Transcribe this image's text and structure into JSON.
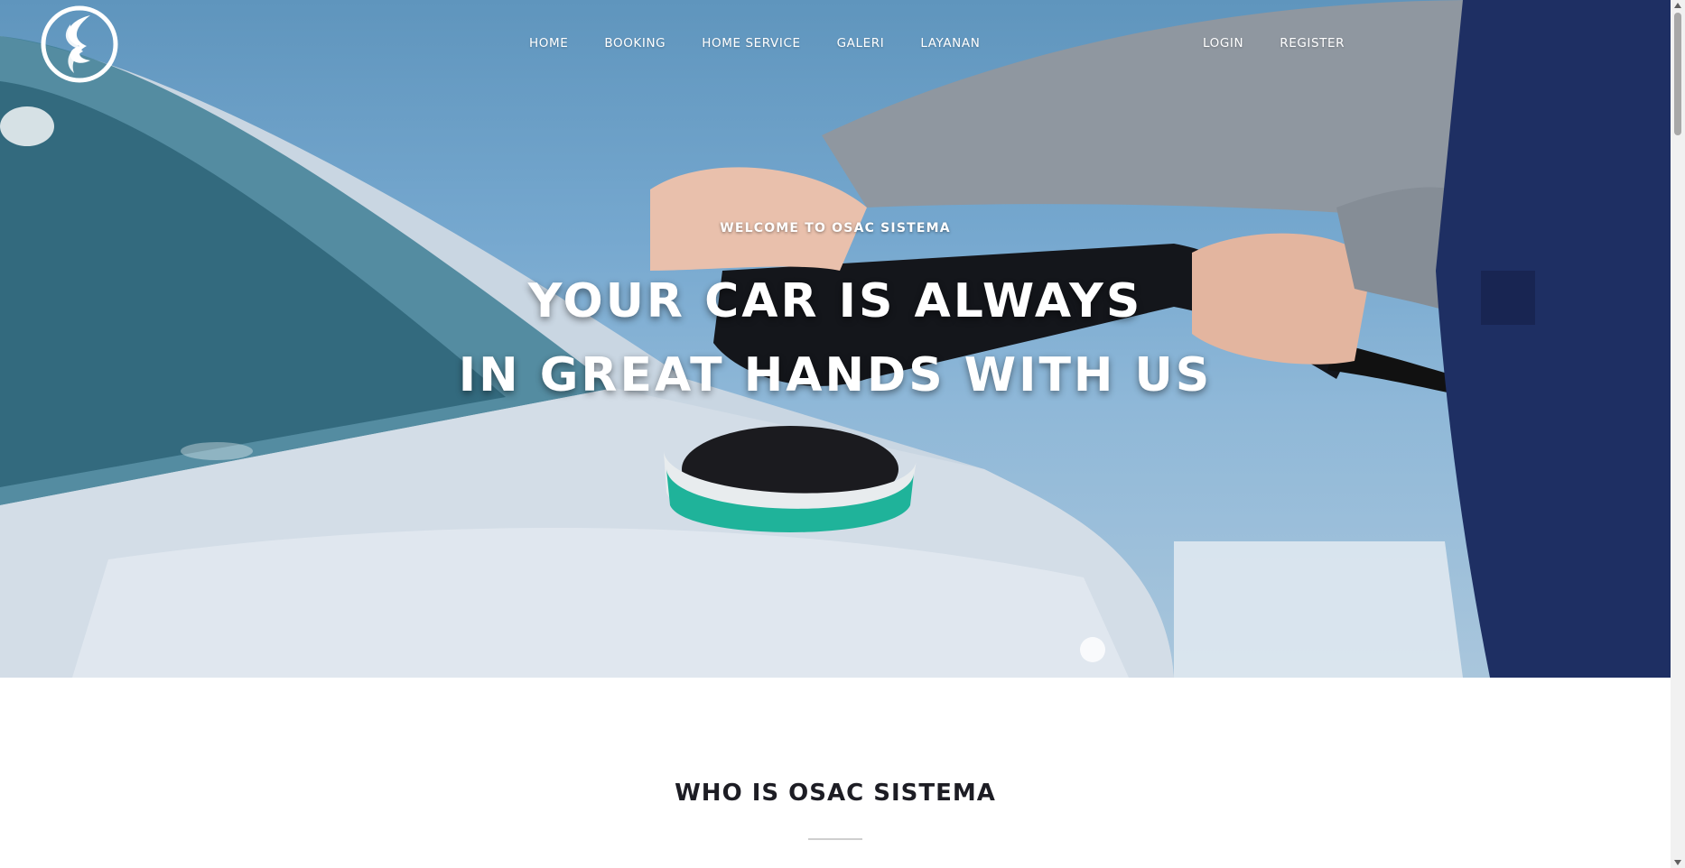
{
  "brand": {
    "logo_icon": "osac-logo-icon"
  },
  "nav": {
    "items": [
      {
        "label": "HOME"
      },
      {
        "label": "BOOKING"
      },
      {
        "label": "HOME SERVICE"
      },
      {
        "label": "GALERI"
      },
      {
        "label": "LAYANAN"
      }
    ],
    "auth": [
      {
        "label": "LOGIN"
      },
      {
        "label": "REGISTER"
      }
    ]
  },
  "hero": {
    "welcome": "WELCOME TO OSAC SISTEMA",
    "headline_line1": "YOUR CAR IS ALWAYS",
    "headline_line2": "IN GREAT HANDS WITH US",
    "image": "car-polishing-photo"
  },
  "about": {
    "title": "WHO IS OSAC SISTEMA"
  },
  "colors": {
    "hero_sky": "#76a8cf",
    "polisher_pad": "#1fb39a",
    "title_text": "#1d1d24"
  }
}
